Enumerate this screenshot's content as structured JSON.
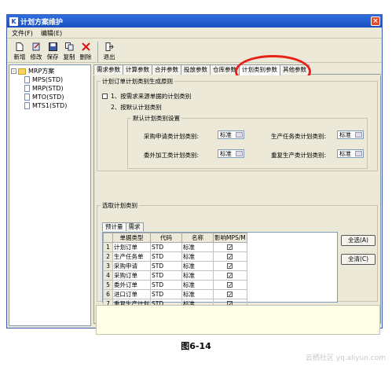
{
  "window": {
    "title": "计划方案维护"
  },
  "menu": [
    "文件(F)",
    "编辑(E)"
  ],
  "toolbar": [
    {
      "label": "新增",
      "icon": "new-doc-icon"
    },
    {
      "label": "修改",
      "icon": "edit-icon"
    },
    {
      "label": "保存",
      "icon": "save-icon"
    },
    {
      "label": "复制",
      "icon": "copy-icon"
    },
    {
      "label": "删除",
      "icon": "delete-icon"
    },
    {
      "label": "退出",
      "icon": "exit-icon"
    }
  ],
  "tree": {
    "root": "MRP方案",
    "children": [
      "MPS(STD)",
      "MRP(STD)",
      "MTO(STD)",
      "MTS1(STD)"
    ]
  },
  "tabs": [
    "需求参数",
    "计算参数",
    "合并参数",
    "投放参数",
    "仓库参数",
    "计划类别参数",
    "其他参数"
  ],
  "active_tab": 5,
  "rule_group": {
    "legend": "计划订单计划类别生成原则",
    "option1": "1、按需求来源单据的计划类别",
    "option2": "2、按默认计划类别",
    "default_group": {
      "legend": "默认计划类别设置",
      "purchase_label": "采购申请类计划类别:",
      "purchase_value": "标准",
      "production_label": "生产任务类计划类别:",
      "production_value": "标准",
      "outsource_label": "委外加工类计划类别:",
      "outsource_value": "标准",
      "rework_label": "重复生产类计划类别:",
      "rework_value": "标准"
    }
  },
  "select_group": {
    "legend": "选取计划类别",
    "subtabs": [
      "预计量",
      "需求"
    ],
    "columns": [
      "单据类型",
      "代码",
      "名称",
      "影响MPS/M"
    ],
    "rows": [
      {
        "n": "1",
        "type": "计划订单",
        "code": "STD",
        "name": "标准",
        "checked": true
      },
      {
        "n": "2",
        "type": "生产任务单",
        "code": "STD",
        "name": "标准",
        "checked": true
      },
      {
        "n": "3",
        "type": "采购申请",
        "code": "STD",
        "name": "标准",
        "checked": true
      },
      {
        "n": "4",
        "type": "采购订单",
        "code": "STD",
        "name": "标准",
        "checked": true
      },
      {
        "n": "5",
        "type": "委外订单",
        "code": "STD",
        "name": "标准",
        "checked": true
      },
      {
        "n": "6",
        "type": "进口订单",
        "code": "STD",
        "name": "标准",
        "checked": true
      },
      {
        "n": "7",
        "type": "重复生产计划",
        "code": "STD",
        "name": "标准",
        "checked": true
      }
    ],
    "select_all": "全选(A)",
    "clear_all": "全清(C)"
  },
  "caption": "图6-14",
  "watermark": "云栖社区 yq.aliyun.com"
}
